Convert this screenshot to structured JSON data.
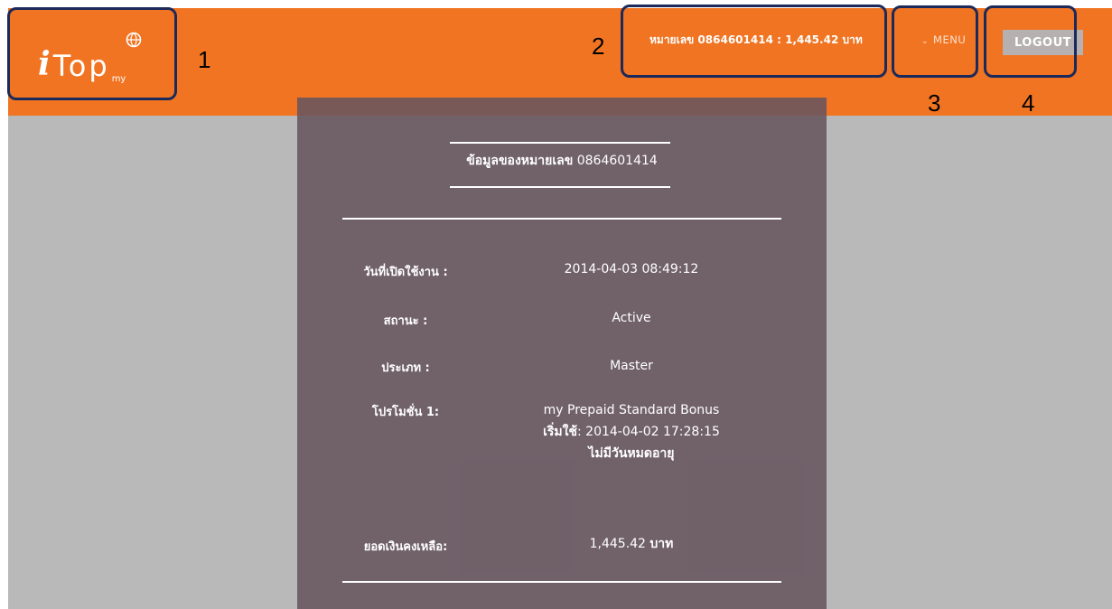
{
  "header": {
    "logo": {
      "text_i": "i",
      "text_top": "Top",
      "text_my": "my"
    },
    "balance_info": "หมายเลข 0864601414 : 1,445.42 บาท",
    "menu_label": "MENU",
    "logout_label": "LOGOUT"
  },
  "panel": {
    "title_label": "ข้อมูลของหมายเลข",
    "title_number": "0864601414",
    "rows": {
      "activation": {
        "label": "วันที่เปิดใช้งาน :",
        "value": "2014-04-03 08:49:12"
      },
      "status": {
        "label": "สถานะ :",
        "value": "Active"
      },
      "type": {
        "label": "ประเภท :",
        "value": "Master"
      },
      "promotion": {
        "label": "โปรโมชั่น 1:",
        "name": "my Prepaid Standard Bonus",
        "start_label": "เริ่มใช้",
        "start_value": ": 2014-04-02 17:28:15",
        "expiry": "ไม่มีวันหมดอายุ"
      },
      "balance": {
        "label": "ยอดเงินคงเหลือ:",
        "amount": "1,445.42",
        "unit": "บาท"
      }
    }
  },
  "annotations": [
    "1",
    "2",
    "3",
    "4"
  ],
  "colors": {
    "header": "#f07422",
    "panel": "#6b5a63",
    "background": "#b9b9b9",
    "annotation_border": "#1b2a5a"
  }
}
